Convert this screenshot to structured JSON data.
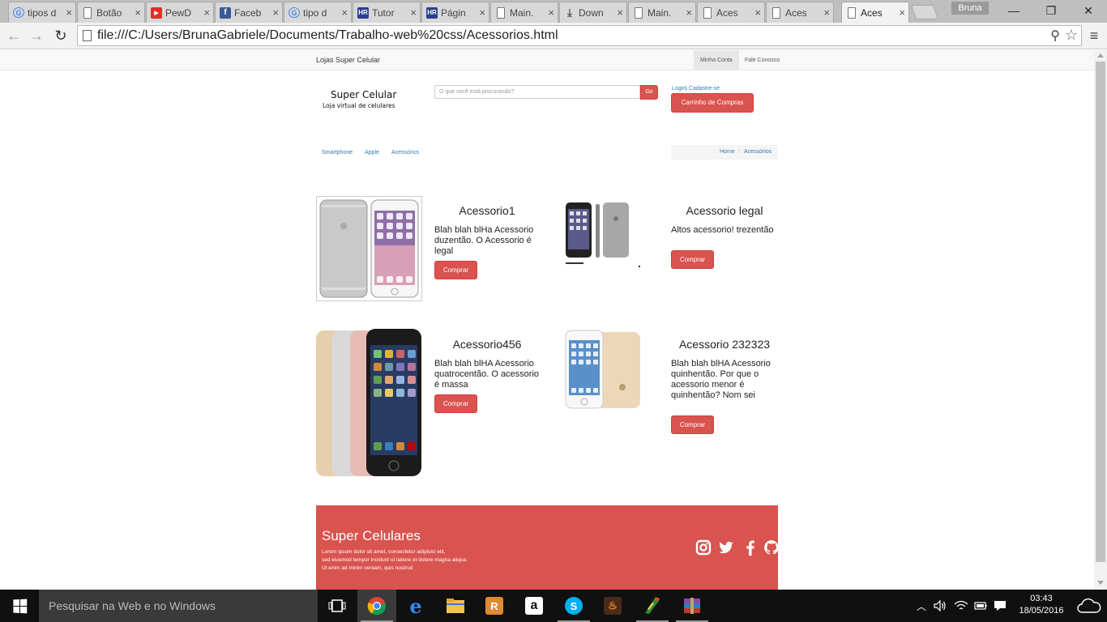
{
  "browser": {
    "tabs": [
      {
        "title": "tipos d",
        "icon": "google-icon"
      },
      {
        "title": "Botão",
        "icon": "document-icon"
      },
      {
        "title": "PewD",
        "icon": "youtube-icon"
      },
      {
        "title": "Faceb",
        "icon": "facebook-icon"
      },
      {
        "title": "tipo d",
        "icon": "google-icon"
      },
      {
        "title": "Tutor",
        "icon": "hr-icon"
      },
      {
        "title": "Págin",
        "icon": "hr-icon"
      },
      {
        "title": "Main.",
        "icon": "document-icon"
      },
      {
        "title": "Down",
        "icon": "download-icon"
      },
      {
        "title": "Main.",
        "icon": "document-icon"
      },
      {
        "title": "Aces",
        "icon": "document-icon"
      },
      {
        "title": "Aces",
        "icon": "document-icon"
      },
      {
        "title": "Aces",
        "icon": "document-icon",
        "active": true
      }
    ],
    "profile_name": "Bruna",
    "url": "file:///C:/Users/BrunaGabriele/Documents/Trabalho-web%20css/Acessorios.html"
  },
  "site": {
    "brand": "Lojas Super Celular",
    "top_links": {
      "account": "Minha Conta",
      "contact": "Fale Conosco"
    },
    "logo_title": "Super Celular",
    "logo_subtitle": "Loja virtual de celulares",
    "search_placeholder": "O que você está procurando?",
    "search_button": "Go",
    "login_link": "Login| Cadastre-se",
    "cart_button": "Carrinho de Compras",
    "categories": [
      "Smartphone",
      "Apple",
      "Acessórios"
    ],
    "breadcrumb": [
      "Home",
      "Acessórios"
    ],
    "breadcrumb_separator": "/",
    "buy_label": "Comprar",
    "products": [
      {
        "title": "Acessorio1",
        "description": "Blah blah blHa Acessorio duzentão. O Acessorio é legal"
      },
      {
        "title": "Acessorio legal",
        "description": "Altos acessorio! trezentão"
      },
      {
        "title": "Acessorio456",
        "description": "Blah blah blHA Acessorio quatrocentão. O acessorio é massa"
      },
      {
        "title": "Acessorio 232323",
        "description": "Blah blah blHA Acessorio quinhentão. Por que o acessorio menor é quinhentão? Nom sei"
      }
    ],
    "footer": {
      "title": "Super Celulares",
      "text_lines": [
        "Lorem ipsum dolor sit amet, consectetur adipisici elit,",
        "sed eiusmod tempor incidunt ut labore et dolore magna aliqua.",
        "Ut enim ad minim veniam, quis nostrud"
      ],
      "social_icons": [
        "instagram-icon",
        "twitter-icon",
        "facebook-icon",
        "github-icon"
      ]
    }
  },
  "taskbar": {
    "search_placeholder": "Pesquisar na Web e no Windows",
    "time": "03:43",
    "date": "18/05/2016"
  },
  "colors": {
    "accent_red": "#d9534f",
    "link_blue": "#337ab7",
    "taskbar": "#101010"
  }
}
